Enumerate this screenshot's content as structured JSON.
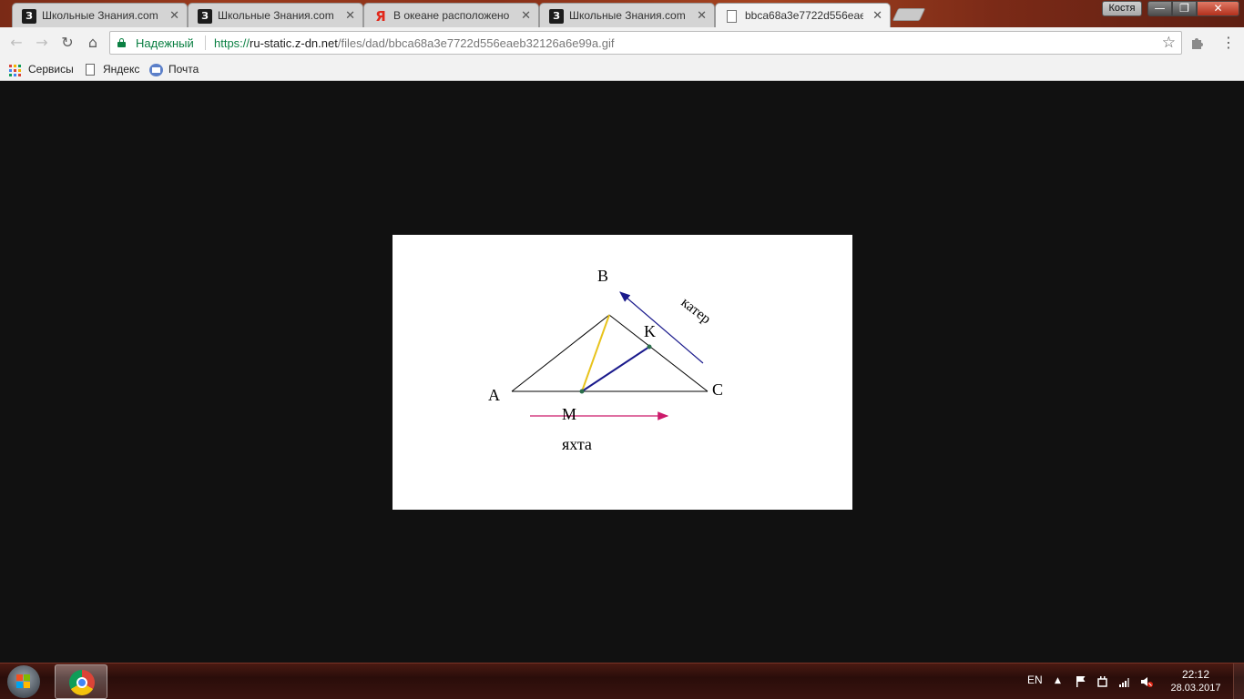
{
  "window": {
    "profile_name": "Костя",
    "controls": {
      "minimize": "—",
      "maximize": "❐",
      "close": "✕"
    }
  },
  "tabs": [
    {
      "title": "Школьные Знания.com",
      "icon": "znania-icon",
      "favicon_text": "З",
      "active": false
    },
    {
      "title": "Школьные Знания.com",
      "icon": "znania-icon",
      "favicon_text": "З",
      "active": false
    },
    {
      "title": "В океане расположено",
      "icon": "yandex-icon",
      "favicon_text": "Я",
      "active": false
    },
    {
      "title": "Школьные Знания.com",
      "icon": "znania-icon",
      "favicon_text": "З",
      "active": false
    },
    {
      "title": "bbca68a3e7722d556eaeb32126a6e99a.gif",
      "icon": "page-icon",
      "favicon_text": "",
      "active": true
    }
  ],
  "toolbar": {
    "back": "←",
    "forward": "→",
    "reload": "↻",
    "home": "⌂",
    "secure_label": "Надежный",
    "url_scheme": "https://",
    "url_host": "ru-static.z-dn.net",
    "url_path": "/files/dad/bbca68a3e7722d556eaeb32126a6e99a.gif",
    "star": "☆",
    "menu": "⋮"
  },
  "bookmarks": [
    {
      "label": "Сервисы",
      "icon": "apps-icon"
    },
    {
      "label": "Яндекс",
      "icon": "document-icon"
    },
    {
      "label": "Почта",
      "icon": "mail-icon"
    }
  ],
  "diagram": {
    "labels": {
      "A": "A",
      "B": "B",
      "C": "C",
      "K": "K",
      "M": "M",
      "boat": "катер",
      "yacht": "яхта"
    },
    "colors": {
      "triangle": "#000000",
      "segment_BM": "#e8c31c",
      "segment_MK": "#1a1a8c",
      "arrow_boat": "#1a1a8c",
      "arrow_yacht": "#cc1a6b"
    }
  },
  "taskbar": {
    "language": "EN",
    "time": "22:12",
    "date": "28.03.2017",
    "tray_arrow": "▲"
  }
}
